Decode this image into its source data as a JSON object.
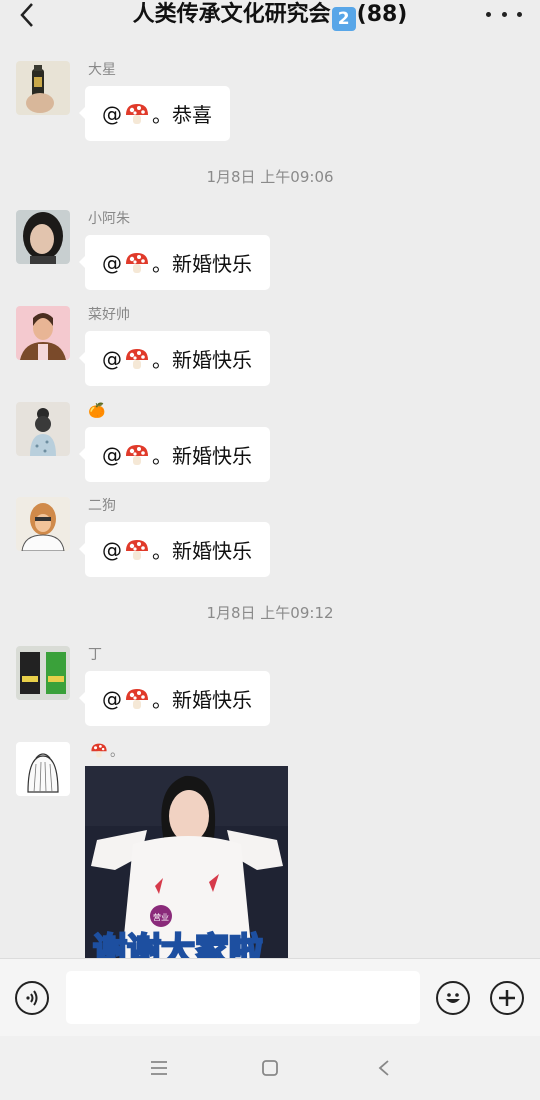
{
  "header": {
    "title_prefix": "人类传承文化研究会",
    "title_badge": "2",
    "title_count": "(88)",
    "back_icon": "chevron-left-icon",
    "more_icon": "more-dots-icon"
  },
  "messages": [
    {
      "nick": "大星",
      "at": "@",
      "text": "。恭喜"
    },
    {
      "nick": "小阿朱",
      "at": "@",
      "text": "。新婚快乐"
    },
    {
      "nick": "菜好帅",
      "at": "@",
      "text": "。新婚快乐"
    },
    {
      "nick": "🍊",
      "at": "@",
      "text": "。新婚快乐"
    },
    {
      "nick": "二狗",
      "at": "@",
      "text": "。新婚快乐"
    },
    {
      "nick": "丁",
      "at": "@",
      "text": "。新婚快乐"
    }
  ],
  "timestamps": [
    "1月8日 上午09:06",
    "1月8日 上午09:12"
  ],
  "last_message": {
    "nick_suffix": "。",
    "image_caption": "谢谢大家啦",
    "badge_text": "营业"
  },
  "input": {
    "value": "",
    "placeholder": "",
    "voice_icon": "voice-icon",
    "emoji_icon": "emoji-icon",
    "plus_icon": "plus-icon"
  },
  "navbar": {
    "icons": [
      "menu-icon",
      "home-square-icon",
      "back-triangle-icon"
    ]
  },
  "colors": {
    "background": "#ededed",
    "bubble": "#ffffff",
    "muted_text": "#888888"
  }
}
